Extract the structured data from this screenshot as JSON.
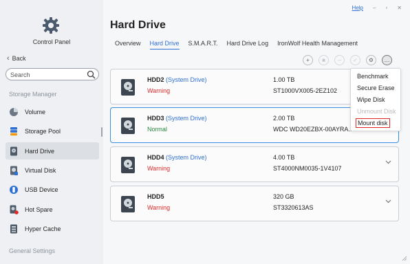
{
  "sidebar": {
    "app_title": "Control Panel",
    "back_label": "Back",
    "search_placeholder": "Search",
    "section_storage": "Storage Manager",
    "items": [
      {
        "label": "Volume",
        "icon": "volume-icon"
      },
      {
        "label": "Storage Pool",
        "icon": "storage-pool-icon"
      },
      {
        "label": "Hard Drive",
        "icon": "hard-drive-icon",
        "active": true
      },
      {
        "label": "Virtual Disk",
        "icon": "virtual-disk-icon"
      },
      {
        "label": "USB Device",
        "icon": "usb-icon"
      },
      {
        "label": "Hot Spare",
        "icon": "hot-spare-icon"
      },
      {
        "label": "Hyper Cache",
        "icon": "hyper-cache-icon"
      }
    ],
    "section_general": "General Settings"
  },
  "header": {
    "help_label": "Help",
    "title": "Hard Drive",
    "tabs": [
      "Overview",
      "Hard Drive",
      "S.M.A.R.T.",
      "Hard Drive Log",
      "IronWolf Health Management"
    ],
    "active_tab": "Hard Drive"
  },
  "drives": [
    {
      "name": "HDD2",
      "tag": "(System Drive)",
      "status": "Warning",
      "capacity": "1.00 TB",
      "model": "ST1000VX005-2EZ102"
    },
    {
      "name": "HDD3",
      "tag": "(System Drive)",
      "status": "Normal",
      "capacity": "2.00 TB",
      "model": "WDC WD20EZBX-00AYRA..."
    },
    {
      "name": "HDD4",
      "tag": "(System Drive)",
      "status": "Warning",
      "capacity": "4.00 TB",
      "model": "ST4000NM0035-1V4107"
    },
    {
      "name": "HDD5",
      "tag": "",
      "status": "Warning",
      "capacity": "320 GB",
      "model": "ST3320613AS"
    }
  ],
  "dropdown": {
    "items": [
      {
        "label": "Benchmark",
        "enabled": true
      },
      {
        "label": "Secure Erase",
        "enabled": true
      },
      {
        "label": "Wipe Disk",
        "enabled": true
      },
      {
        "label": "Unmount Disk",
        "enabled": false
      },
      {
        "label": "Mount disk",
        "enabled": true,
        "highlighted": true
      }
    ]
  },
  "colors": {
    "accent": "#2d6fd3",
    "warning": "#e02a2a",
    "normal": "#2b8a3e",
    "highlight_box": "#e02424"
  }
}
